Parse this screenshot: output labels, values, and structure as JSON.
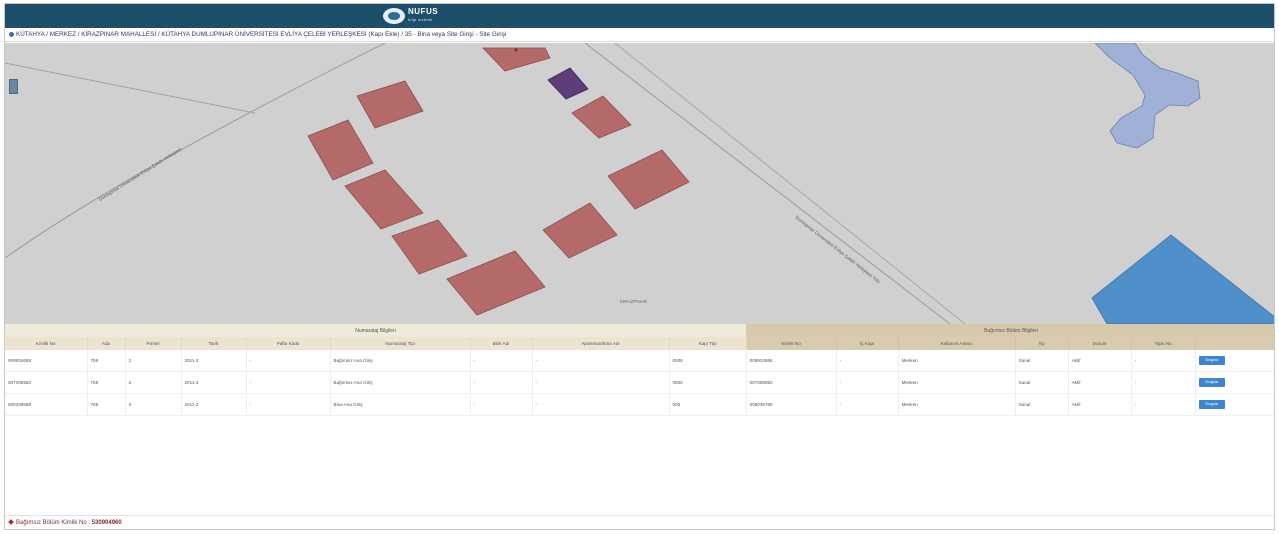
{
  "header": {
    "logo_title": "NUFUS",
    "logo_subtitle": "bilgi sistemi"
  },
  "breadcrumb": {
    "text": "KÜTAHYA / MERKEZ / KİRAZPINAR MAHALLESİ / KÜTAHYA DUMLUPINAR ÜNİVERSİTESİ EVLİYA ÇELEBİ YERLEŞKESİ (Kapı Ekle) / 35 - Bina veya Site Girişi - Site Girişi"
  },
  "map": {
    "street_labels": [
      "Dumlupınar Üniversitesi Evliya Çelebi Yerleşkesi",
      "Dumlupınar Üniversitesi Evliya Çelebi Yerleşkesi Yolu",
      "KIRAZPINAR"
    ]
  },
  "table": {
    "group_left": "Numarataj Bilgileri",
    "group_right": "Bağımsız Bölüm Bilgileri",
    "columns": [
      "Kimlik No",
      "Ada",
      "Parsel",
      "Tarih",
      "Pafta Kodu",
      "Numarataj Tipi",
      "Blok Adı",
      "Apartman/Bina Adı",
      "Kapı Tipi",
      "Kimlik No",
      "İç Kapı",
      "Kullanım Amacı",
      "Tip",
      "Durum",
      "Tapu No",
      ""
    ],
    "rows": [
      {
        "cells": [
          "009934688",
          "768",
          "2",
          "2011-3",
          "-",
          "Bağımsız Ana Giriş",
          "-",
          "-",
          "0005",
          "009934688",
          "-",
          "Mesken",
          "Sanal",
          "Aktif",
          "-"
        ],
        "button": "Sorgula"
      },
      {
        "cells": [
          "007395982",
          "768",
          "3",
          "2011-3",
          "-",
          "Bağımsız Ana Giriş",
          "-",
          "-",
          "0005",
          "007395982",
          "-",
          "Mesken",
          "Sanal",
          "Aktif",
          "-"
        ],
        "button": "Sorgula"
      },
      {
        "cells": [
          "005339688",
          "768",
          "3",
          "2011-3",
          "-",
          "Bina Ana Giriş",
          "-",
          "-",
          "005",
          "008035788",
          "-",
          "Mesken",
          "Sanal",
          "Aktif",
          "-"
        ],
        "button": "Sorgula"
      }
    ]
  },
  "footer": {
    "label": "Bağımsız Bölüm Kimlik No :",
    "value": "530904960"
  },
  "colors": {
    "topbar": "#1d4f6b",
    "building": "#b56a6a",
    "selected_building": "#5e3d7a",
    "water": "#9fb1d6",
    "parcel": "#4f8fca",
    "map_bg": "#d0d0d0"
  }
}
